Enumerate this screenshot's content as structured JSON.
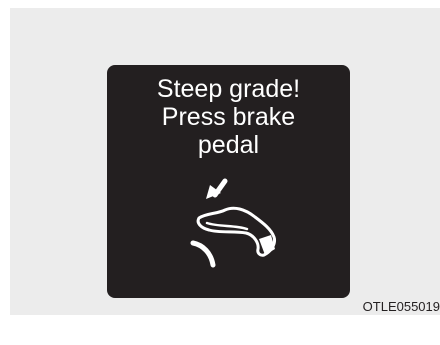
{
  "warning": {
    "line1": "Steep grade!",
    "line2": "Press brake",
    "line3": "pedal",
    "icon": "foot-on-brake-pedal-icon"
  },
  "figure_code": "OTLE055019",
  "colors": {
    "display_bg": "#231f20",
    "frame_bg": "#ececec",
    "text": "#ffffff"
  }
}
